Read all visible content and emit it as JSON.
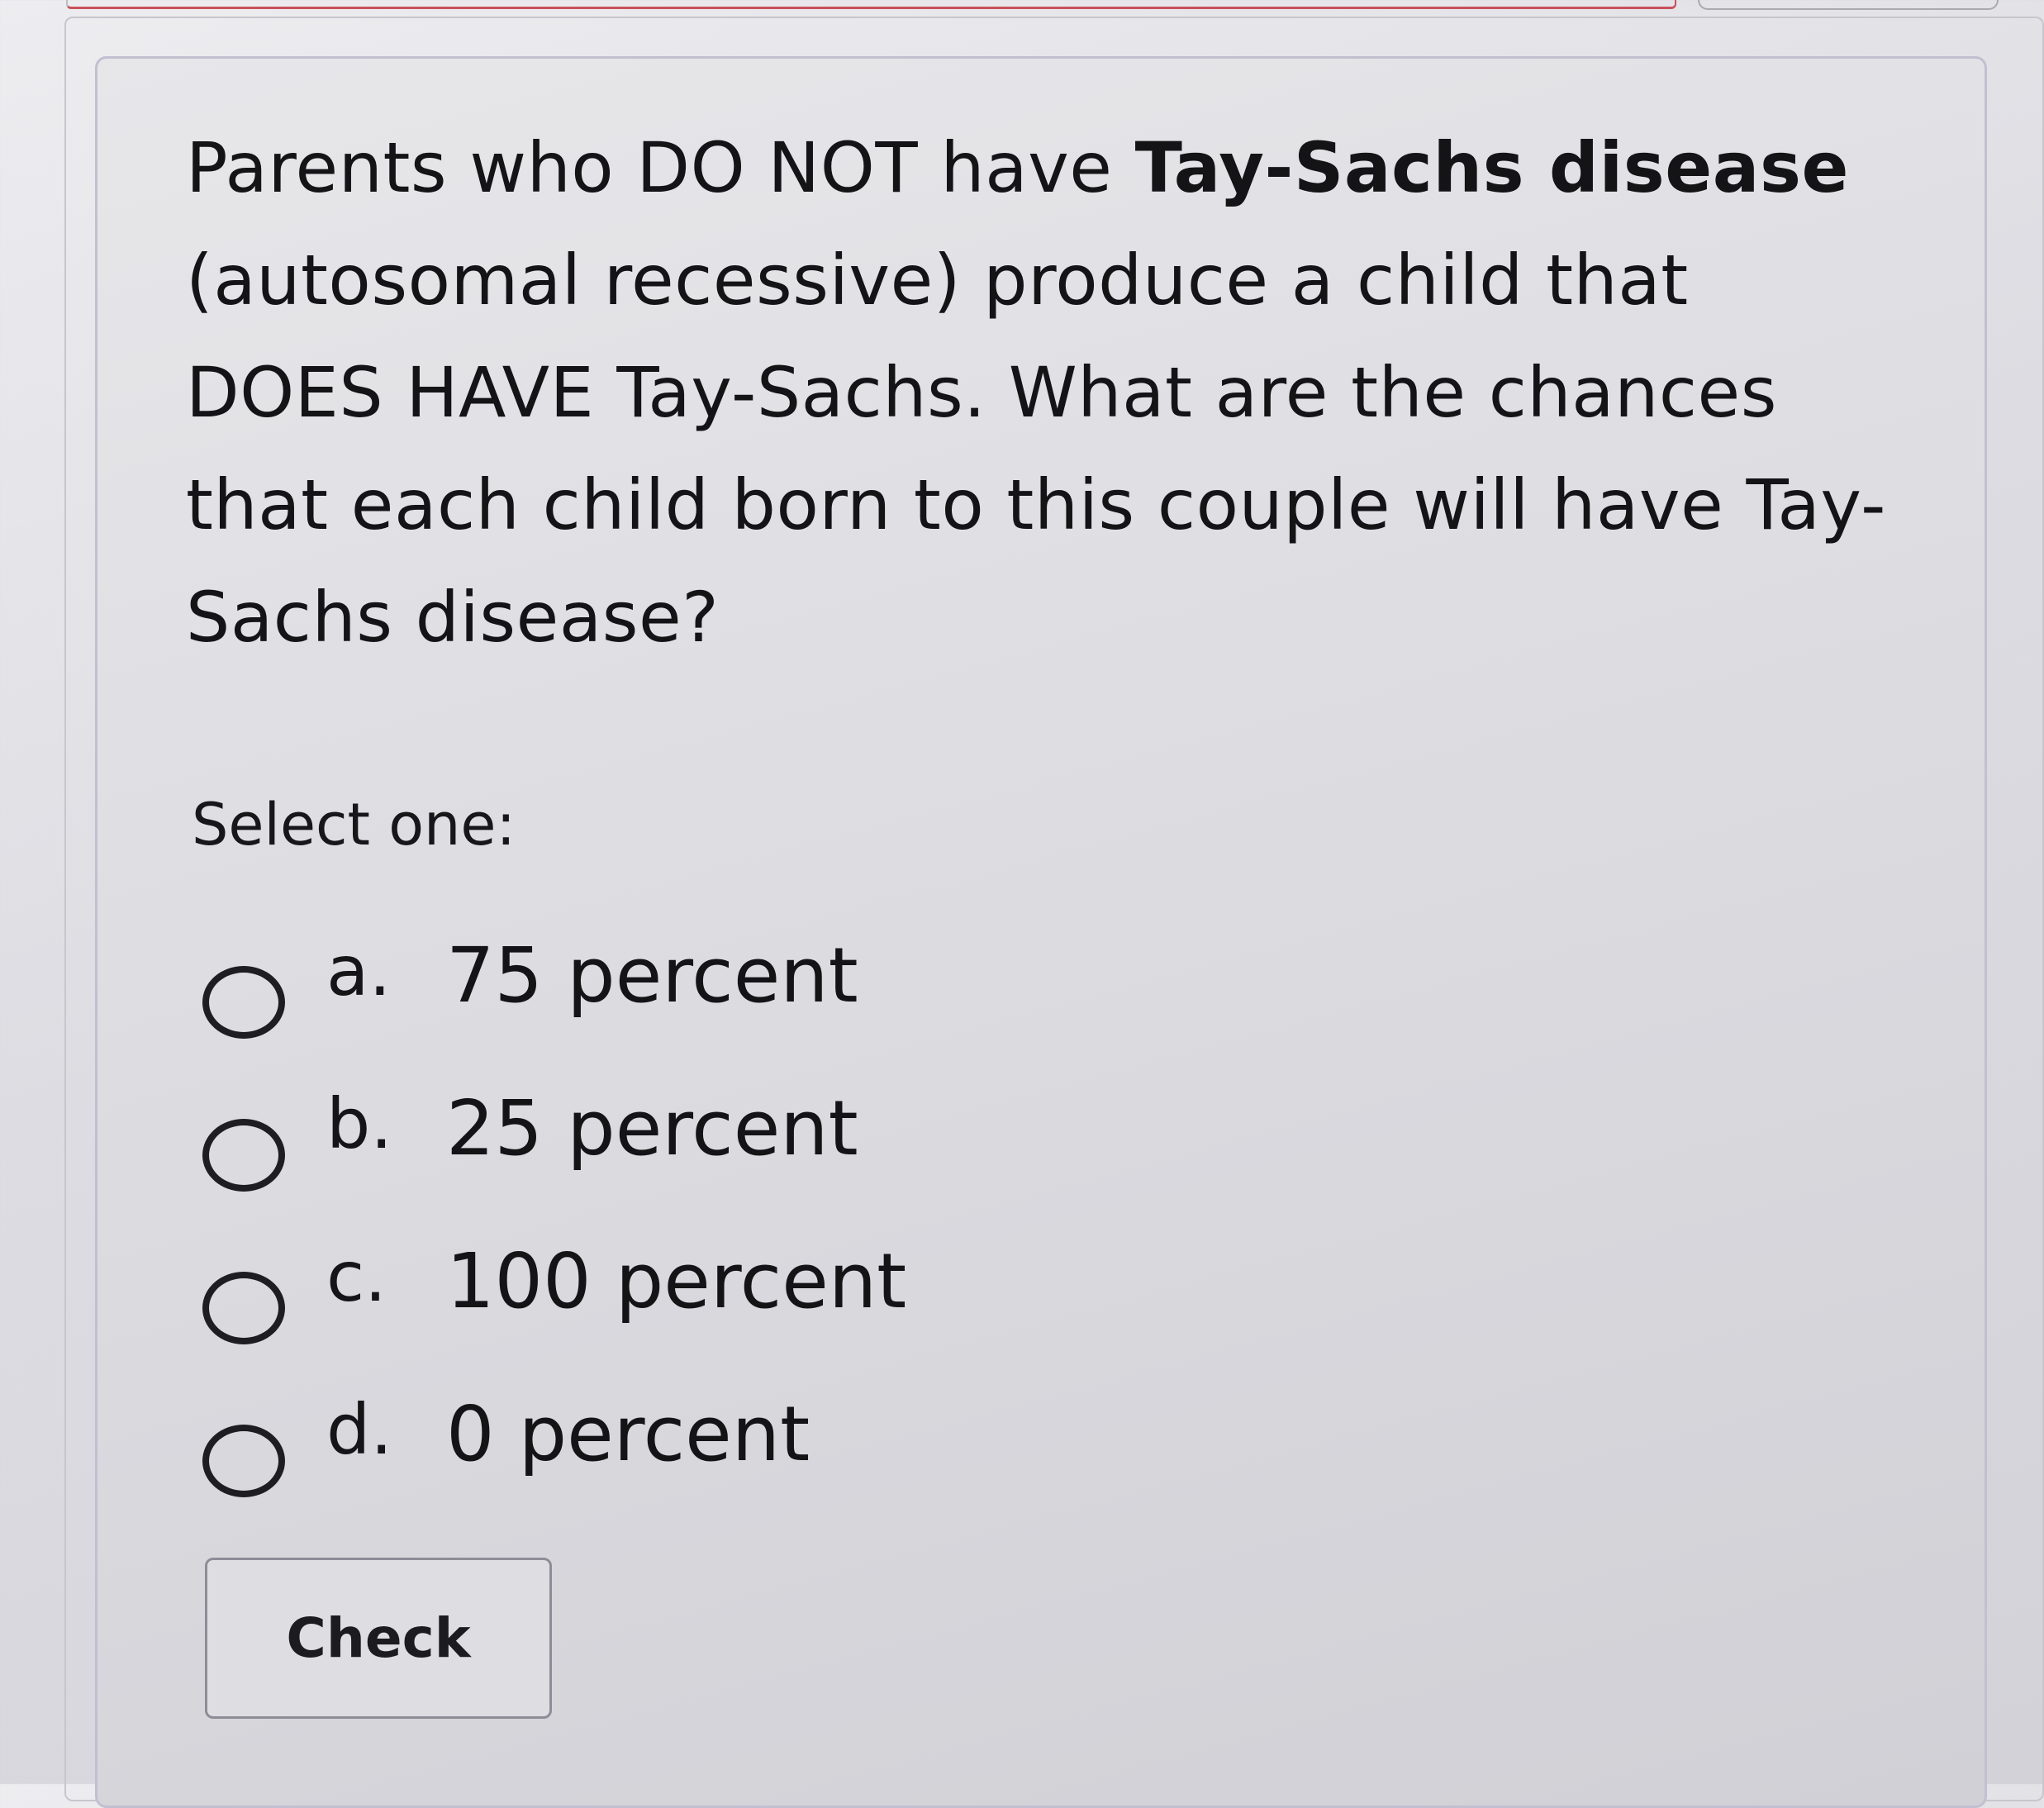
{
  "question": {
    "part1": "Parents who DO NOT have ",
    "bold": "Tay-Sachs disease",
    "part2": " (autosomal recessive) produce a child that DOES HAVE Tay-Sachs. What are the chances that each child born to this couple will have Tay-Sachs disease?"
  },
  "select_prompt": "Select one:",
  "options": [
    {
      "letter": "a.",
      "text": "75 percent"
    },
    {
      "letter": "b.",
      "text": "25 percent"
    },
    {
      "letter": "c.",
      "text": "100 percent"
    },
    {
      "letter": "d.",
      "text": "0 percent"
    }
  ],
  "check_button_label": "Check"
}
